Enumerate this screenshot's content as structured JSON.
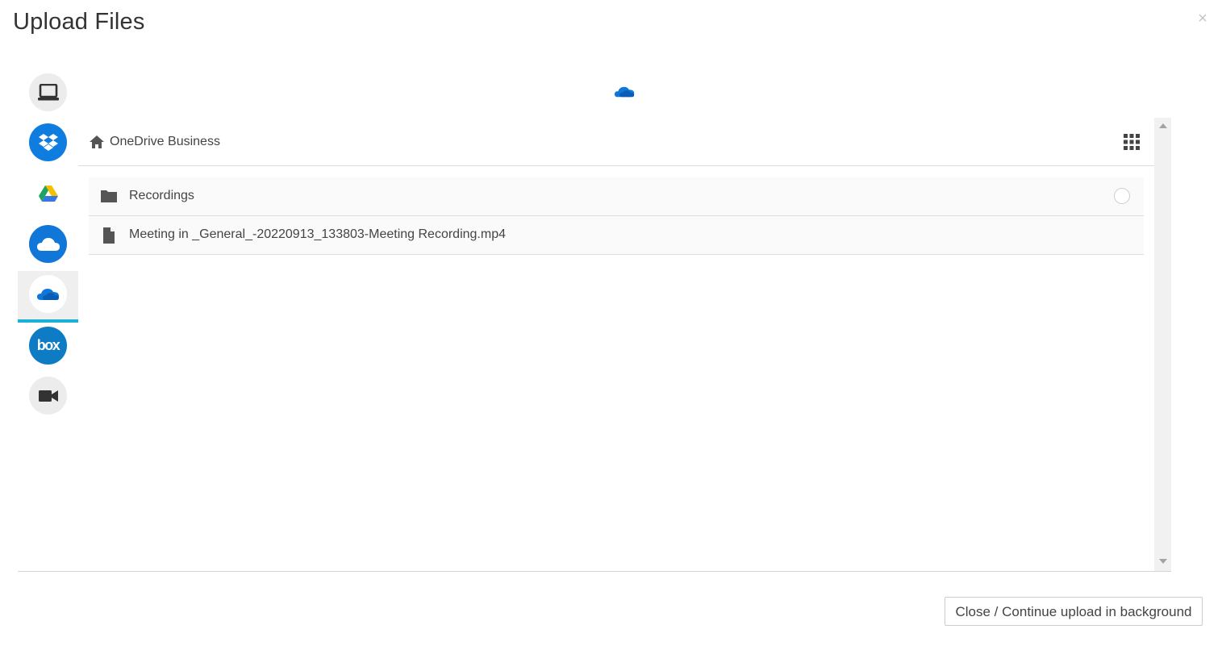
{
  "dialog": {
    "title": "Upload Files",
    "close_symbol": "×"
  },
  "sources": [
    {
      "id": "computer",
      "icon": "laptop-icon",
      "bg": "#ececec",
      "active": false
    },
    {
      "id": "dropbox",
      "icon": "dropbox-icon",
      "bg": "#0f7ddf",
      "active": false
    },
    {
      "id": "google-drive",
      "icon": "google-drive-icon",
      "bg": "#ffffff",
      "active": false
    },
    {
      "id": "onedrive",
      "icon": "onedrive-icon",
      "bg": "#1076d7",
      "active": false
    },
    {
      "id": "onedrive-business",
      "icon": "onedrive-business-icon",
      "bg": "#ffffff",
      "active": true
    },
    {
      "id": "box",
      "icon": "box-icon",
      "bg": "#0e7bc5",
      "label": "box",
      "active": false
    },
    {
      "id": "video",
      "icon": "video-camera-icon",
      "bg": "#ececec",
      "active": false
    }
  ],
  "browser": {
    "breadcrumb": "OneDrive Business",
    "items": [
      {
        "type": "folder",
        "name": "Recordings"
      },
      {
        "type": "file",
        "name": "Meeting in _General_-20220913_133803-Meeting Recording.mp4"
      }
    ]
  },
  "footer": {
    "close_label": "Close / Continue upload in background"
  },
  "colors": {
    "accent_underline": "#1bb0d6",
    "onedrive_blue": "#1076d7"
  }
}
